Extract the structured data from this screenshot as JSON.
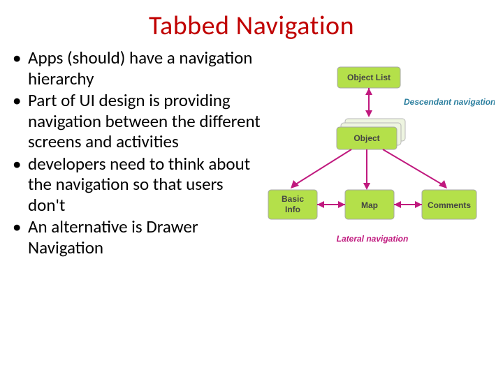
{
  "title": "Tabbed Navigation",
  "bullets": [
    "Apps (should) have a navigation hierarchy",
    "Part of UI design is providing navigation between the different screens and activities",
    "developers need to think about the navigation so that users don't",
    "An alternative is Drawer Navigation"
  ],
  "diagram": {
    "top": "Object List",
    "mid": "Object",
    "bottom": [
      "Basic\nInfo",
      "Map",
      "Comments"
    ],
    "descendant": "Descendant navigation",
    "lateral": "Lateral navigation"
  }
}
